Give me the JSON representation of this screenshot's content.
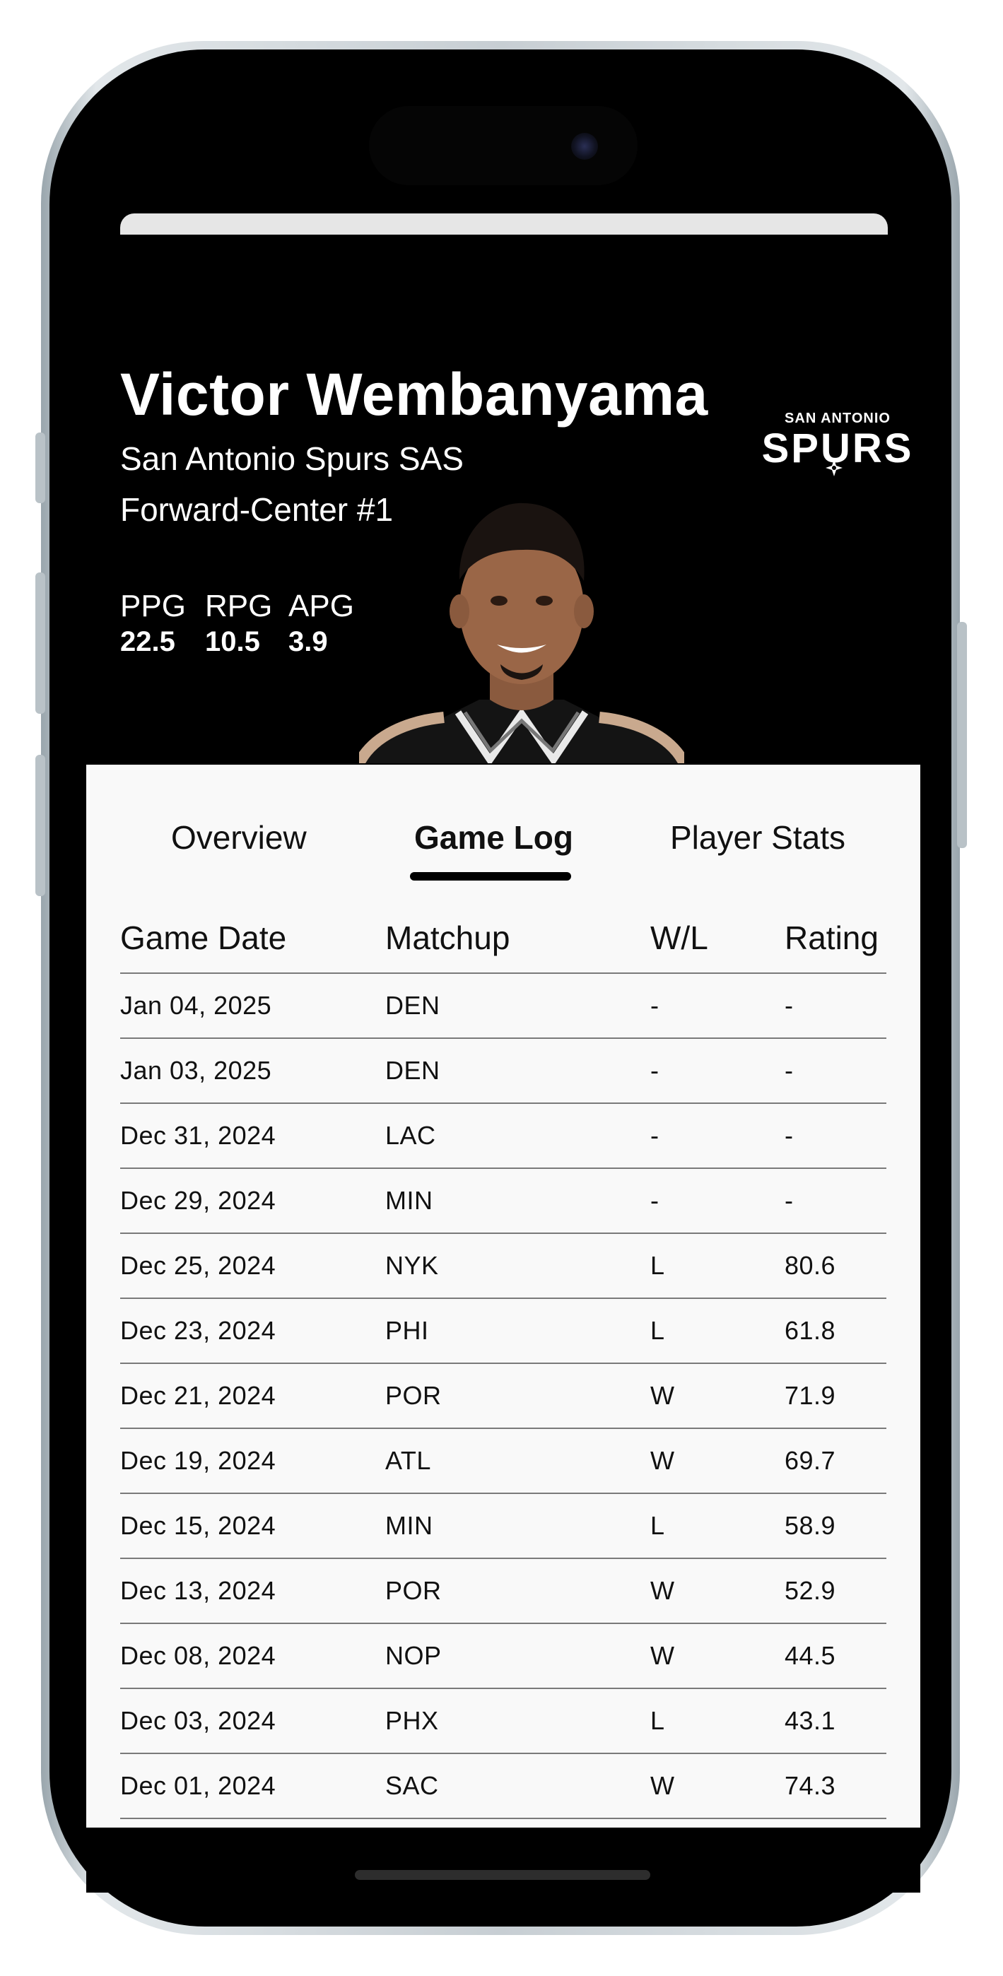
{
  "player": {
    "name": "Victor Wembanyama",
    "team_line": "San Antonio Spurs SAS",
    "position_line": "Forward-Center #1"
  },
  "team_logo": {
    "top_text": "SAN ANTONIO",
    "main_text": "SPURS"
  },
  "stats": [
    {
      "label": "PPG",
      "value": "22.5"
    },
    {
      "label": "RPG",
      "value": "10.5"
    },
    {
      "label": "APG",
      "value": "3.9"
    }
  ],
  "tabs": [
    {
      "label": "Overview",
      "active": false
    },
    {
      "label": "Game Log",
      "active": true
    },
    {
      "label": "Player Stats",
      "active": false
    }
  ],
  "table": {
    "headers": [
      "Game Date",
      "Matchup",
      "W/L",
      "Rating"
    ],
    "rows": [
      [
        "Jan 04, 2025",
        "DEN",
        "-",
        "-"
      ],
      [
        "Jan 03, 2025",
        "DEN",
        "-",
        "-"
      ],
      [
        "Dec 31, 2024",
        "LAC",
        "-",
        "-"
      ],
      [
        "Dec 29, 2024",
        "MIN",
        "-",
        "-"
      ],
      [
        "Dec 25, 2024",
        "NYK",
        "L",
        "80.6"
      ],
      [
        "Dec 23, 2024",
        "PHI",
        "L",
        "61.8"
      ],
      [
        "Dec 21, 2024",
        "POR",
        "W",
        "71.9"
      ],
      [
        "Dec 19, 2024",
        "ATL",
        "W",
        "69.7"
      ],
      [
        "Dec 15, 2024",
        "MIN",
        "L",
        "58.9"
      ],
      [
        "Dec 13, 2024",
        "POR",
        "W",
        "52.9"
      ],
      [
        "Dec 08, 2024",
        "NOP",
        "W",
        "44.5"
      ],
      [
        "Dec 03, 2024",
        "PHX",
        "L",
        "43.1"
      ],
      [
        "Dec 01, 2024",
        "SAC",
        "W",
        "74.3"
      ]
    ]
  },
  "colors": {
    "header_bg": "#000000",
    "panel_bg": "#f9f9f9",
    "text": "#111111",
    "accent": "#000000"
  }
}
